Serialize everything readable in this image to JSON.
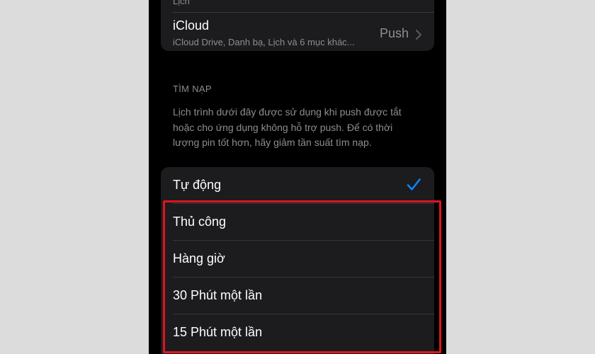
{
  "mail_group": {
    "prev_row_subtitle": "Lịch",
    "icloud": {
      "title": "iCloud",
      "subtitle": "iCloud Drive, Danh bạ, Lịch và 6 mục khác...",
      "value": "Push"
    }
  },
  "fetch_section": {
    "header": "TÌM NẠP",
    "description": "Lịch trình dưới đây được sử dụng khi push được tắt hoặc cho ứng dụng không hỗ trợ push. Để có thời lượng pin tốt hơn, hãy giảm tần suất tìm nạp."
  },
  "fetch_options": [
    {
      "label": "Tự động",
      "selected": true
    },
    {
      "label": "Thủ công",
      "selected": false
    },
    {
      "label": "Hàng giờ",
      "selected": false
    },
    {
      "label": "30 Phút một lần",
      "selected": false
    },
    {
      "label": "15 Phút một lần",
      "selected": false
    }
  ],
  "colors": {
    "accent": "#0a84ff",
    "highlight": "#e0141e",
    "background": "#000000",
    "cell": "#1c1c1e"
  },
  "icons": {
    "chevron": "chevron-right-icon",
    "check": "checkmark-icon"
  }
}
